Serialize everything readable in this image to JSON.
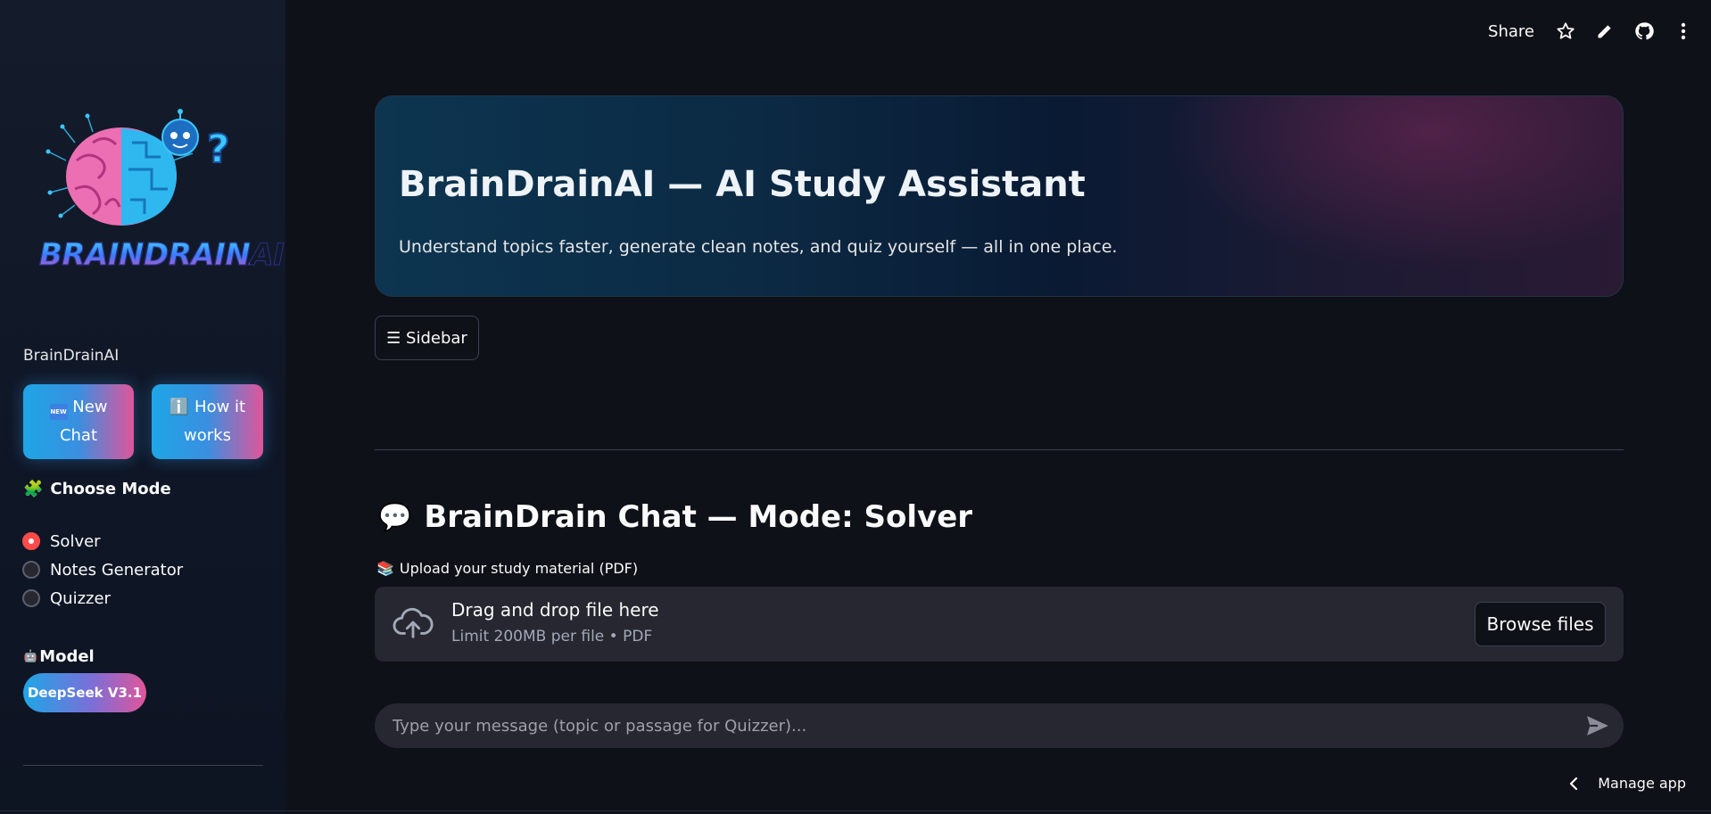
{
  "topbar": {
    "share_label": "Share",
    "icons": [
      "star-icon",
      "pencil-icon",
      "github-icon",
      "more-vertical-icon"
    ]
  },
  "sidebar": {
    "logo_text": "BRAINDRAINAI",
    "brand": "BrainDrainAI",
    "buttons": {
      "new_chat": {
        "emoji": "NEW",
        "line1": "New",
        "line2": "Chat"
      },
      "how_it_works": {
        "emoji": "ℹ️",
        "line1": "How it",
        "line2": "works"
      }
    },
    "mode_section": {
      "emoji": "🧩",
      "title": "Choose Mode",
      "options": [
        "Solver",
        "Notes Generator",
        "Quizzer"
      ],
      "selected": "Solver"
    },
    "model_section": {
      "emoji": "🤖",
      "title": "Model",
      "value": "DeepSeek V3.1"
    }
  },
  "hero": {
    "title": "BrainDrainAI — AI Study Assistant",
    "subtitle": "Understand topics faster, generate clean notes, and quiz yourself — all in one place."
  },
  "sidebar_toggle": {
    "label": "☰ Sidebar"
  },
  "chat": {
    "emoji": "💬",
    "title": "BrainDrain Chat — Mode: Solver"
  },
  "upload": {
    "emoji": "📚",
    "label": "Upload your study material (PDF)",
    "drop_text": "Drag and drop file here",
    "limit_text": "Limit 200MB per file • PDF",
    "browse_label": "Browse files"
  },
  "chat_input": {
    "placeholder": "Type your message (topic or passage for Quizzer)..."
  },
  "footer": {
    "manage_app_label": "Manage app"
  },
  "colors": {
    "background": "#0e1117",
    "sidebar_bg": "#141c2c",
    "accent_red": "#ff4b4b",
    "gradient_blue": "#1ea6e6",
    "gradient_pink": "#e0559a",
    "surface": "#262730"
  }
}
